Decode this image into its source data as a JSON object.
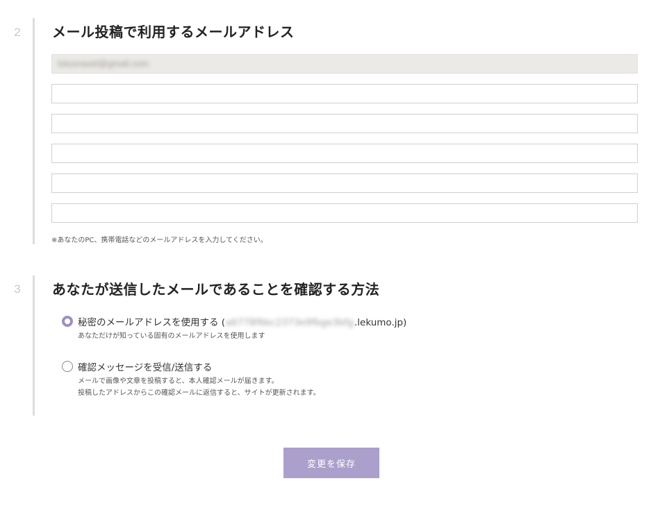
{
  "section2": {
    "number": "2",
    "title": "メール投稿で利用するメールアドレス",
    "readonly_email": "lotusnavel@gmail.com",
    "email_inputs": [
      {
        "value": ""
      },
      {
        "value": ""
      },
      {
        "value": ""
      },
      {
        "value": ""
      },
      {
        "value": ""
      }
    ],
    "note": "※あなたのPC、携帯電話などのメールアドレスを入力してください。"
  },
  "section3": {
    "number": "3",
    "title": "あなたが送信したメールであることを確認する方法",
    "options": [
      {
        "label_prefix": "秘密のメールアドレスを使用する (",
        "label_secret": "a6778f6bc2373e9fbge3bfg",
        "label_suffix": ".lekumo.jp)",
        "description_lines": [
          "あなただけが知っている固有のメールアドレスを使用します"
        ],
        "selected": true
      },
      {
        "label": "確認メッセージを受信/送信する",
        "description_lines": [
          "メールで画像や文章を投稿すると、本人確認メールが届きます。",
          "投稿したアドレスからこの確認メールに返信すると、サイトが更新されます。"
        ],
        "selected": false
      }
    ]
  },
  "actions": {
    "save_label": "変更を保存"
  },
  "colors": {
    "accent": "#9d8fc4",
    "button": "#ab9fcc",
    "readonly_bg": "#eceae6",
    "step_bar": "#dddddd"
  }
}
